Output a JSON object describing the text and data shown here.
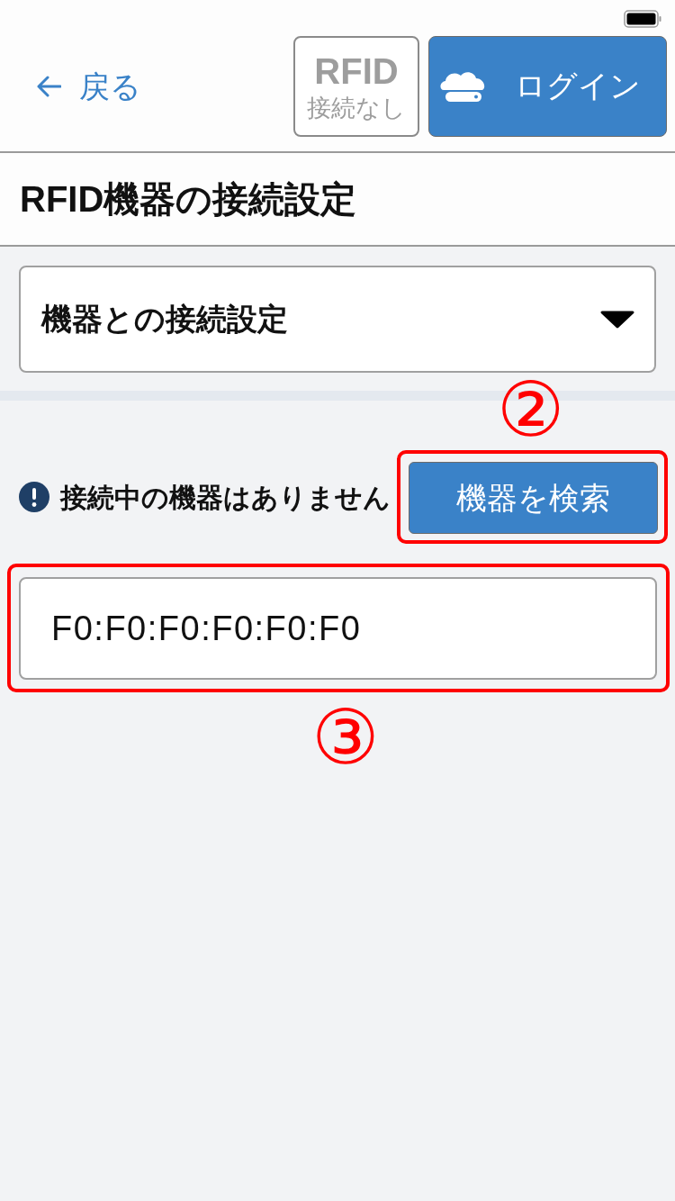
{
  "header": {
    "back_link": {
      "label": "戻る"
    },
    "rfid_status": {
      "title": "RFID",
      "status": "接続なし",
      "connected": false
    },
    "login_button": {
      "label": "ログイン"
    }
  },
  "page_title": "RFID機器の接続設定",
  "accordion": {
    "label": "機器との接続設定",
    "expanded": false
  },
  "connection_notice": {
    "message": "接続中の機器はありません"
  },
  "search_button": {
    "label": "機器を検索",
    "annotation": "②"
  },
  "device_list": {
    "annotation": "③",
    "items": [
      {
        "address": "F0:F0:F0:F0:F0:F0"
      }
    ]
  }
}
